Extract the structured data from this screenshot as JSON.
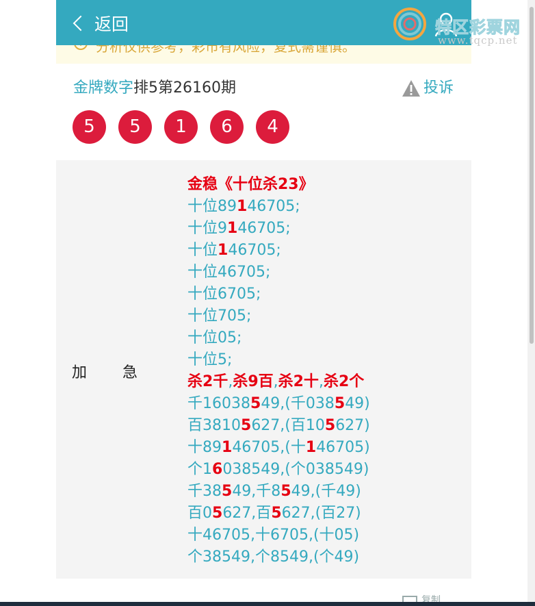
{
  "header": {
    "back_label": "返回"
  },
  "watermark": {
    "title": "特区彩票网",
    "url": "www.tqcp.net"
  },
  "notice": {
    "text": "分析仅供参考，彩市有风险，复式需谨慎。"
  },
  "article": {
    "brand": "金牌数字",
    "issue": "排5第26160期",
    "complain_label": "投诉",
    "balls": [
      "5",
      "5",
      "1",
      "6",
      "4"
    ]
  },
  "prediction": {
    "category": "加急",
    "category_chars": [
      "加",
      "急"
    ],
    "lines": [
      {
        "segments": [
          {
            "t": "金稳《十位杀23》",
            "red": true
          }
        ]
      },
      {
        "segments": [
          {
            "t": "十位89",
            "red": false
          },
          {
            "t": "1",
            "red": true
          },
          {
            "t": "46705;",
            "red": false
          }
        ]
      },
      {
        "segments": [
          {
            "t": "十位9",
            "red": false
          },
          {
            "t": "1",
            "red": true
          },
          {
            "t": "46705;",
            "red": false
          }
        ]
      },
      {
        "segments": [
          {
            "t": "十位",
            "red": false
          },
          {
            "t": "1",
            "red": true
          },
          {
            "t": "46705;",
            "red": false
          }
        ]
      },
      {
        "segments": [
          {
            "t": "十位46705;",
            "red": false
          }
        ]
      },
      {
        "segments": [
          {
            "t": "十位6705;",
            "red": false
          }
        ]
      },
      {
        "segments": [
          {
            "t": "十位705;",
            "red": false
          }
        ]
      },
      {
        "segments": [
          {
            "t": "十位05;",
            "red": false
          }
        ]
      },
      {
        "segments": [
          {
            "t": "十位5;",
            "red": false
          }
        ]
      },
      {
        "segments": [
          {
            "t": "杀2千",
            "red": true
          },
          {
            "t": ",",
            "red": false
          },
          {
            "t": "杀9百",
            "red": true
          },
          {
            "t": ",",
            "red": false
          },
          {
            "t": "杀2十",
            "red": true
          },
          {
            "t": ",",
            "red": false
          },
          {
            "t": "杀2个",
            "red": true
          }
        ]
      },
      {
        "segments": [
          {
            "t": "千16038",
            "red": false
          },
          {
            "t": "5",
            "red": true
          },
          {
            "t": "49,(千038",
            "red": false
          },
          {
            "t": "5",
            "red": true
          },
          {
            "t": "49)",
            "red": false
          }
        ]
      },
      {
        "segments": [
          {
            "t": "百3810",
            "red": false
          },
          {
            "t": "5",
            "red": true
          },
          {
            "t": "627,(百10",
            "red": false
          },
          {
            "t": "5",
            "red": true
          },
          {
            "t": "627)",
            "red": false
          }
        ]
      },
      {
        "segments": [
          {
            "t": "十89",
            "red": false
          },
          {
            "t": "1",
            "red": true
          },
          {
            "t": "46705,(十",
            "red": false
          },
          {
            "t": "1",
            "red": true
          },
          {
            "t": "46705)",
            "red": false
          }
        ]
      },
      {
        "segments": [
          {
            "t": "个1",
            "red": false
          },
          {
            "t": "6",
            "red": true
          },
          {
            "t": "038549,(个038549)",
            "red": false
          }
        ]
      },
      {
        "segments": [
          {
            "t": "千38",
            "red": false
          },
          {
            "t": "5",
            "red": true
          },
          {
            "t": "49,千8",
            "red": false
          },
          {
            "t": "5",
            "red": true
          },
          {
            "t": "49,(千49)",
            "red": false
          }
        ]
      },
      {
        "segments": [
          {
            "t": "百0",
            "red": false
          },
          {
            "t": "5",
            "red": true
          },
          {
            "t": "627,百",
            "red": false
          },
          {
            "t": "5",
            "red": true
          },
          {
            "t": "627,(百27)",
            "red": false
          }
        ]
      },
      {
        "segments": [
          {
            "t": "十46705,十6705,(十05)",
            "red": false
          }
        ]
      },
      {
        "segments": [
          {
            "t": "个38549,个8549,(个49)",
            "red": false
          }
        ]
      }
    ]
  },
  "footer": {
    "text": "复制"
  },
  "colors": {
    "header": "#34a9bf",
    "accent_text": "#34a9bf",
    "ball": "#dc1c3c",
    "highlight": "#e60012",
    "notice_bg": "#fefbe6"
  }
}
